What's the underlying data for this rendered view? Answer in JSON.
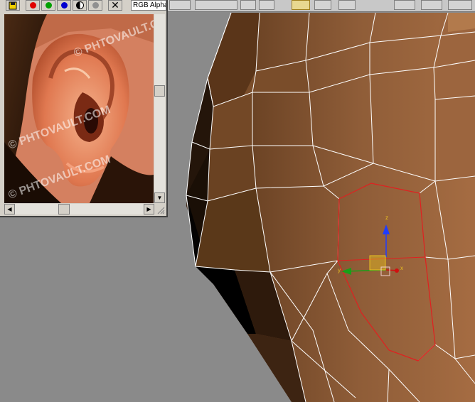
{
  "frame_window": {
    "channel_select": "RGB Alpha",
    "watermark": "© PHTOVAULT.COM",
    "icons": [
      "save-icon",
      "red-channel-icon",
      "green-channel-icon",
      "blue-channel-icon",
      "alpha-channel-icon",
      "mono-channel-icon",
      "clear-icon"
    ]
  },
  "gizmo": {
    "axis_z": "z",
    "axis_y": "y",
    "axis_x": "x"
  },
  "colors": {
    "viewport_bg": "#8a8a8a",
    "skin_mid": "#8a5a37",
    "selection_red": "#e02020",
    "axis_z": "#1e3cff",
    "axis_y": "#18a018",
    "axis_x": "#d01010",
    "gizmo_yellow": "#e8c020"
  }
}
